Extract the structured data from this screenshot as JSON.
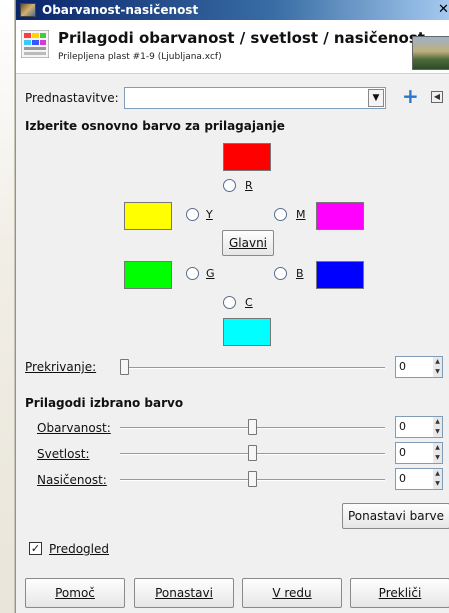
{
  "window": {
    "title": "Obarvanost-nasičenost"
  },
  "header": {
    "title": "Prilagodi obarvanost / svetlost / nasičenost",
    "subtitle": "Prilepljena plast #1-9 (Ljubljana.xcf)"
  },
  "presets": {
    "label": "Prednastavitve:",
    "value": ""
  },
  "primary": {
    "heading": "Izberite osnovno barvo za prilagajanje",
    "master_label": "Glavni",
    "colors": [
      {
        "key": "R",
        "hex": "#ff0000"
      },
      {
        "key": "Y",
        "hex": "#ffff00"
      },
      {
        "key": "M",
        "hex": "#ff00ff"
      },
      {
        "key": "G",
        "hex": "#00ff00"
      },
      {
        "key": "B",
        "hex": "#0000ff"
      },
      {
        "key": "C",
        "hex": "#00ffff"
      }
    ]
  },
  "overlap": {
    "label": "Prekrivanje:",
    "value": "0"
  },
  "adjust": {
    "heading": "Prilagodi izbrano barvo",
    "sliders": [
      {
        "label": "Obarvanost:",
        "value": "0"
      },
      {
        "label": "Svetlost:",
        "value": "0"
      },
      {
        "label": "Nasičenost:",
        "value": "0"
      }
    ],
    "reset_color_label": "Ponastavi barve"
  },
  "preview": {
    "label": "Predogled",
    "checked": true
  },
  "buttons": {
    "help": "Pomoč",
    "reset": "Ponastavi",
    "ok": "V redu",
    "cancel": "Prekliči"
  }
}
